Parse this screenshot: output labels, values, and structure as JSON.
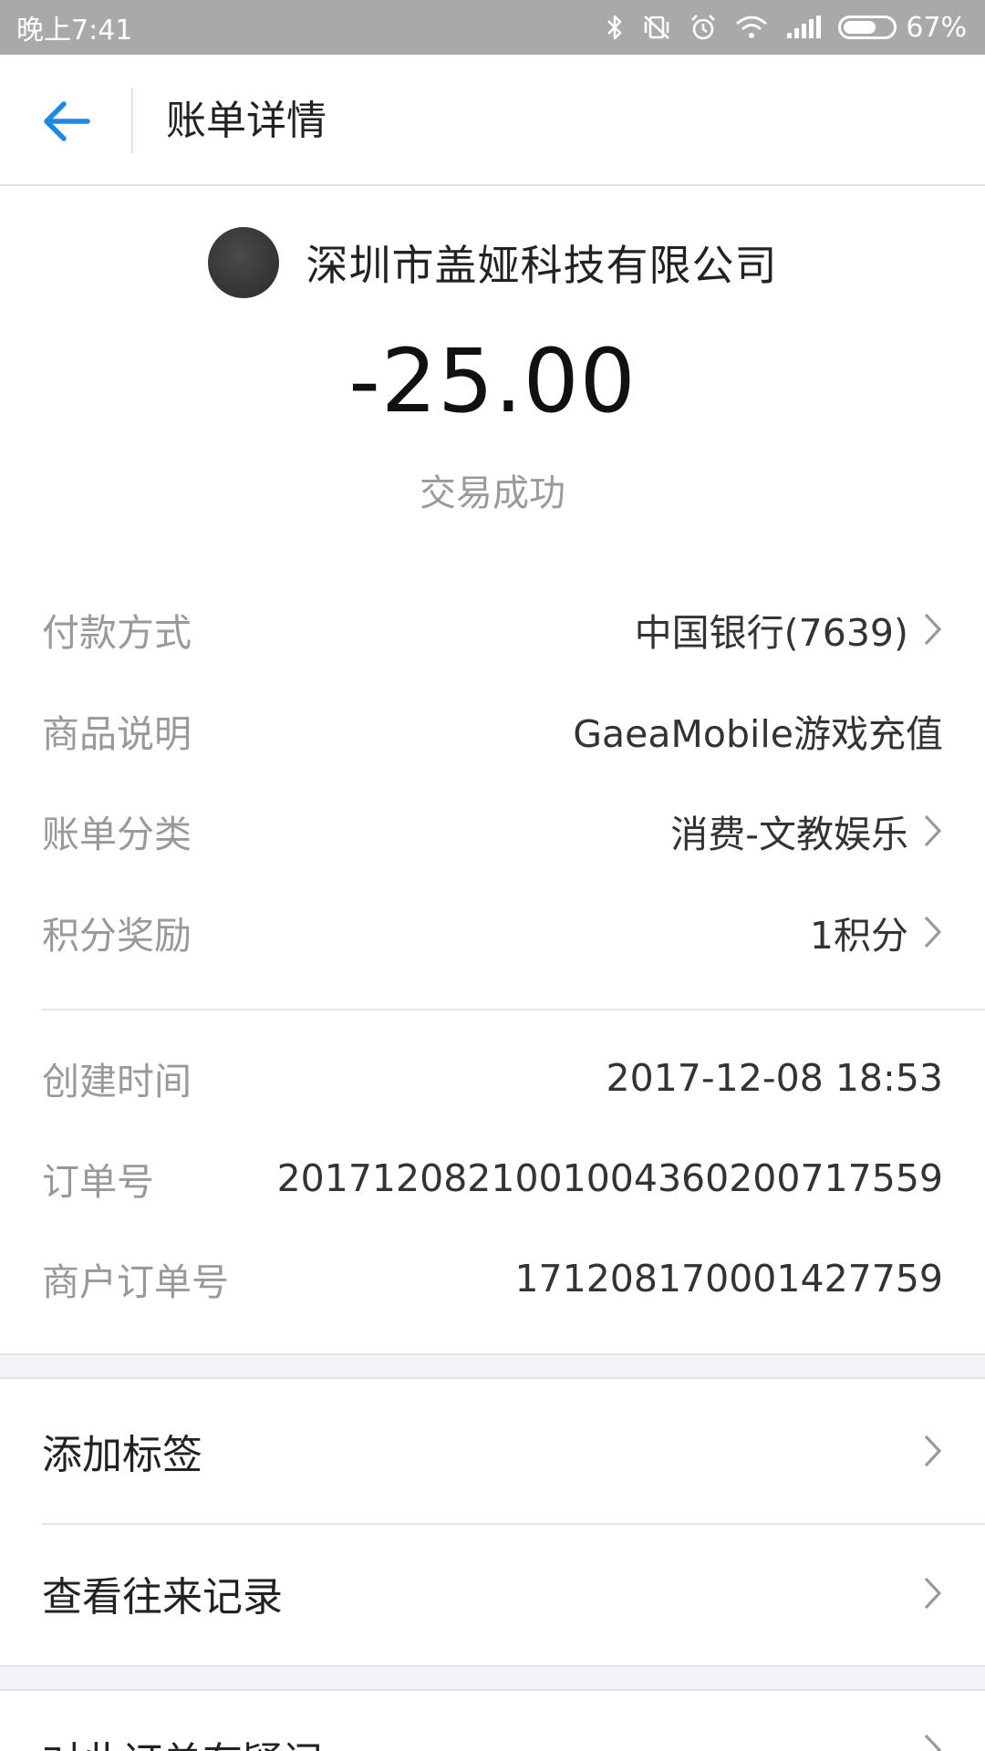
{
  "status_bar": {
    "time": "晚上7:41",
    "battery_percent": "67%",
    "battery_level": 0.67,
    "icons": [
      "bluetooth-icon",
      "vibrate-off-icon",
      "alarm-icon",
      "wifi-icon",
      "signal-icon",
      "battery-icon"
    ]
  },
  "header": {
    "title": "账单详情",
    "back_icon": "arrow-left-icon",
    "accent_color": "#1e88e5"
  },
  "merchant": {
    "name": "深圳市盖娅科技有限公司",
    "amount": "-25.00",
    "status": "交易成功"
  },
  "details": [
    {
      "label": "付款方式",
      "value": "中国银行(7639)",
      "has_chevron": true
    },
    {
      "label": "商品说明",
      "value": "GaeaMobile游戏充值",
      "has_chevron": false
    },
    {
      "label": "账单分类",
      "value": "消费-文教娱乐",
      "has_chevron": true
    },
    {
      "label": "积分奖励",
      "value": "1积分",
      "has_chevron": true
    },
    {
      "label": "创建时间",
      "value": "2017-12-08 18:53",
      "has_chevron": false
    },
    {
      "label": "订单号",
      "value": "2017120821001004360200717559",
      "has_chevron": false
    },
    {
      "label": "商户订单号",
      "value": "171208170001427759",
      "has_chevron": false
    }
  ],
  "actions": [
    {
      "label": "添加标签"
    },
    {
      "label": "查看往来记录"
    }
  ],
  "partial_action": {
    "label": "对此订单有疑问"
  }
}
